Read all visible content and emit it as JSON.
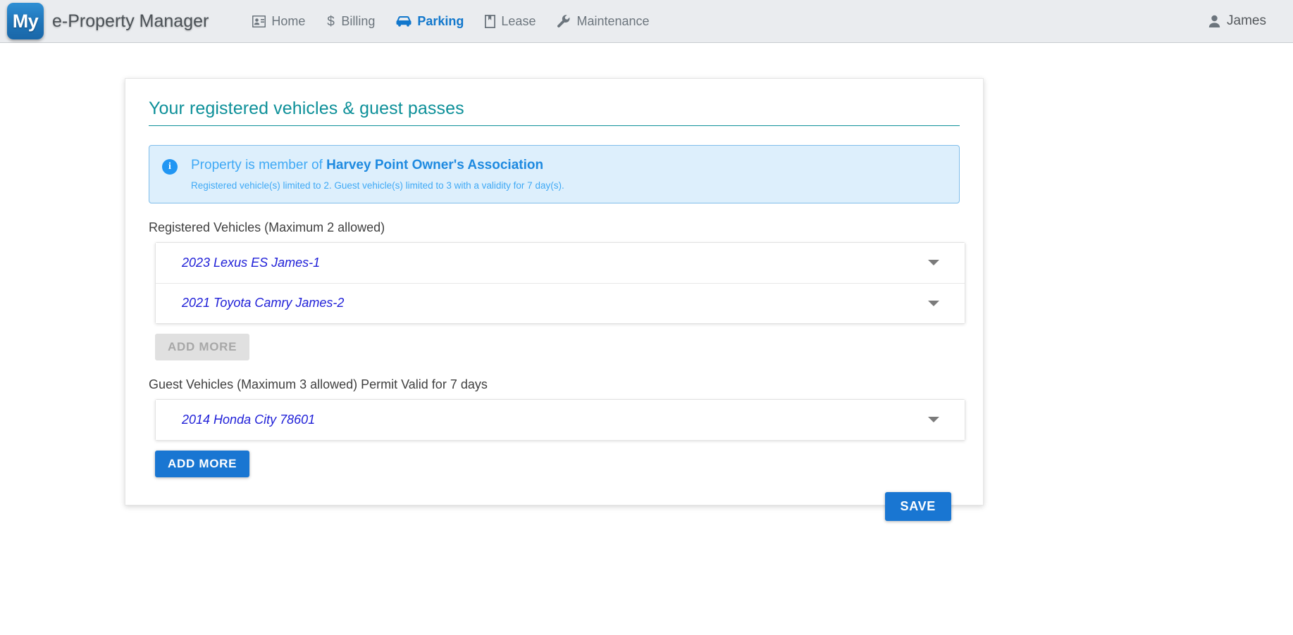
{
  "navbar": {
    "logo_text": "My",
    "brand_name": "e-Property Manager",
    "items": [
      {
        "label": "Home",
        "icon": "contact-card-icon",
        "active": false
      },
      {
        "label": "Billing",
        "icon": "dollar-icon",
        "active": false
      },
      {
        "label": "Parking",
        "icon": "car-icon",
        "active": true
      },
      {
        "label": "Lease",
        "icon": "book-icon",
        "active": false
      },
      {
        "label": "Maintenance",
        "icon": "wrench-icon",
        "active": false
      }
    ],
    "user": {
      "name": "James",
      "icon": "person-icon"
    }
  },
  "card": {
    "title": "Your registered vehicles & guest passes",
    "alert": {
      "icon": "info-icon",
      "text_prefix": "Property is member of ",
      "association": "Harvey Point Owner's Association",
      "subtext": "Registered vehicle(s) limited to 2. Guest vehicle(s) limited to 3 with a validity for 7 day(s)."
    },
    "registered": {
      "label": "Registered Vehicles (Maximum 2 allowed)",
      "vehicles": [
        {
          "name": "2023 Lexus ES James-1"
        },
        {
          "name": "2021 Toyota Camry James-2"
        }
      ],
      "add_more_label": "ADD MORE",
      "add_more_disabled": true
    },
    "guest": {
      "label": "Guest Vehicles (Maximum 3 allowed) Permit Valid for 7 days",
      "vehicles": [
        {
          "name": "2014 Honda City 78601"
        }
      ],
      "add_more_label": "ADD MORE",
      "add_more_disabled": false
    },
    "save_label": "SAVE"
  },
  "colors": {
    "teal": "#0d9099",
    "primary_blue": "#1976d2",
    "alert_blue": "#3fa9f5",
    "vehicle_text": "#2020d8"
  }
}
